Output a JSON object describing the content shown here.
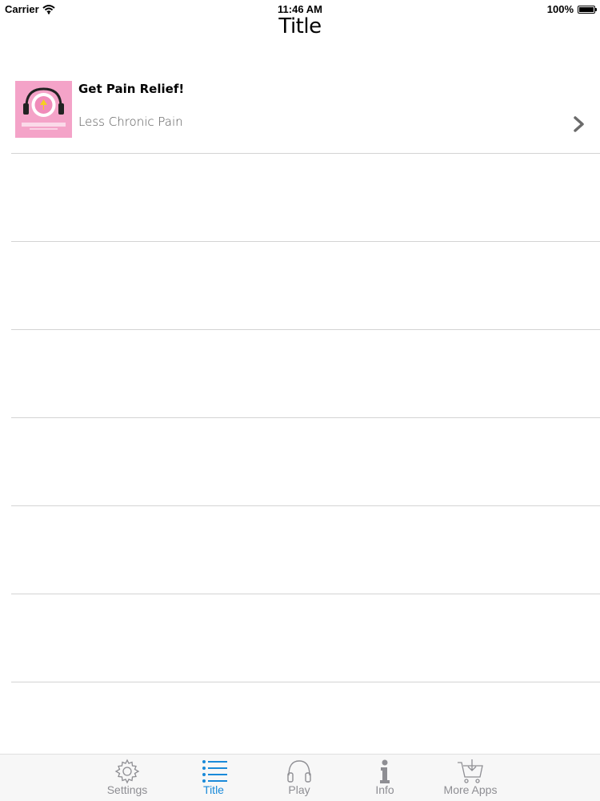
{
  "status_bar": {
    "carrier": "Carrier",
    "time": "11:46 AM",
    "battery": "100%"
  },
  "nav": {
    "title": "Title"
  },
  "list": {
    "items": [
      {
        "title": "Get Pain Relief!",
        "subtitle": "Less Chronic Pain",
        "thumb_text": "GET PAIN RELIEF"
      }
    ]
  },
  "tabbar": {
    "tabs": [
      {
        "label": "Settings",
        "icon": "gear-icon"
      },
      {
        "label": "Title",
        "icon": "list-icon",
        "active": true
      },
      {
        "label": "Play",
        "icon": "headphones-icon"
      },
      {
        "label": "Info",
        "icon": "info-icon"
      },
      {
        "label": "More Apps",
        "icon": "cart-icon"
      }
    ]
  },
  "colors": {
    "accent": "#1a8ad9",
    "inactive": "#8e8e93",
    "thumb_bg": "#f4a3c8"
  }
}
